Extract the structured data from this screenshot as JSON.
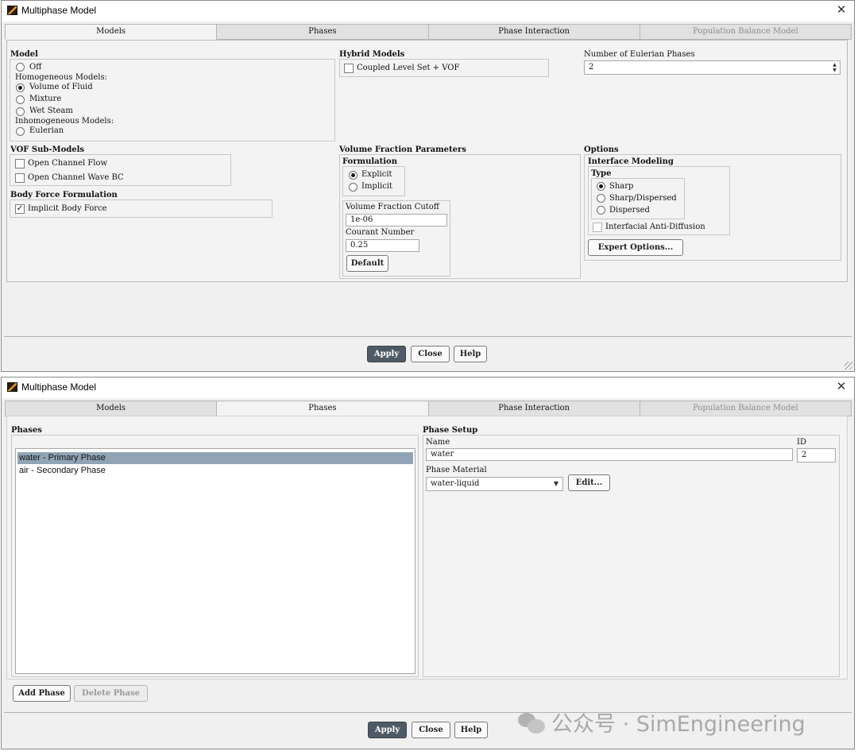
{
  "window1": {
    "title": "Multiphase Model",
    "tabs": [
      {
        "label": "Models",
        "state": "active"
      },
      {
        "label": "Phases",
        "state": "normal"
      },
      {
        "label": "Phase Interaction",
        "state": "normal"
      },
      {
        "label": "Population Balance Model",
        "state": "disabled"
      }
    ],
    "model": {
      "heading": "Model",
      "off": "Off",
      "homogeneous_label": "Homogeneous Models:",
      "vof": "Volume of Fluid",
      "mixture": "Mixture",
      "wet_steam": "Wet Steam",
      "inhomogeneous_label": "Inhomogeneous Models:",
      "eulerian": "Eulerian",
      "selected": "Volume of Fluid"
    },
    "hybrid": {
      "heading": "Hybrid Models",
      "coupled_level_set": "Coupled Level Set + VOF",
      "coupled_level_set_checked": false
    },
    "eulerian_phases": {
      "label": "Number of Eulerian Phases",
      "value": "2"
    },
    "vof_sub_models": {
      "heading": "VOF Sub-Models",
      "open_channel_flow": "Open Channel Flow",
      "open_channel_wave_bc": "Open Channel Wave BC"
    },
    "body_force": {
      "heading": "Body Force Formulation",
      "implicit_body_force": "Implicit Body Force",
      "implicit_checked": true
    },
    "vf_params": {
      "heading": "Volume Fraction Parameters",
      "formulation_heading": "Formulation",
      "explicit": "Explicit",
      "implicit": "Implicit",
      "selected": "Explicit",
      "cutoff_label": "Volume Fraction Cutoff",
      "cutoff_value": "1e-06",
      "courant_label": "Courant Number",
      "courant_value": "0.25",
      "default_button": "Default"
    },
    "options": {
      "heading": "Options",
      "interface_heading": "Interface Modeling",
      "type_heading": "Type",
      "sharp": "Sharp",
      "sharp_dispersed": "Sharp/Dispersed",
      "dispersed": "Dispersed",
      "selected": "Sharp",
      "anti_diffusion": "Interfacial Anti-Diffusion",
      "expert_button": "Expert Options..."
    },
    "buttons": {
      "apply": "Apply",
      "close": "Close",
      "help": "Help"
    }
  },
  "window2": {
    "title": "Multiphase Model",
    "tabs": [
      {
        "label": "Models",
        "state": "normal"
      },
      {
        "label": "Phases",
        "state": "active"
      },
      {
        "label": "Phase Interaction",
        "state": "normal"
      },
      {
        "label": "Population Balance Model",
        "state": "disabled"
      }
    ],
    "phases": {
      "heading": "Phases",
      "items": [
        {
          "label": "water - Primary Phase",
          "selected": true
        },
        {
          "label": "air - Secondary Phase",
          "selected": false
        }
      ],
      "add_button": "Add Phase",
      "delete_button": "Delete Phase"
    },
    "phase_setup": {
      "heading": "Phase Setup",
      "name_label": "Name",
      "name_value": "water",
      "id_label": "ID",
      "id_value": "2",
      "material_label": "Phase Material",
      "material_value": "water-liquid",
      "edit_button": "Edit..."
    },
    "buttons": {
      "apply": "Apply",
      "close": "Close",
      "help": "Help"
    }
  },
  "watermark": {
    "text": "公众号 · SimEngineering"
  },
  "colors": {
    "window_bg": "#f0f0f0",
    "apply_button": "#4e5a66",
    "list_selection": "#90a4b6",
    "disabled_text": "#8c8c8c"
  }
}
